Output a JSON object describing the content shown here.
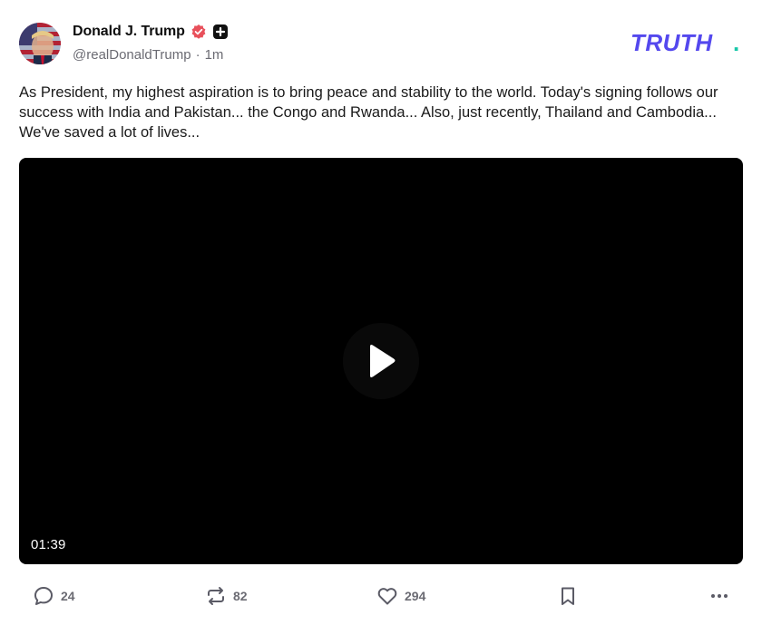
{
  "post": {
    "author": {
      "display_name": "Donald J. Trump",
      "verified_icon": "verified-badge-icon",
      "plus_icon": "plus-square-icon",
      "handle": "@realDonaldTrump",
      "separator": "·",
      "timestamp": "1m",
      "avatar_icon": "avatar-image"
    },
    "brand": {
      "logo_text": "TRUTH",
      "logo_dot": ".",
      "primary_color": "#5448ee",
      "accent_color": "#17c7a8"
    },
    "text": "As President, my highest aspiration is to bring peace and stability to the world. Today's signing follows our success with India and Pakistan... the Congo and Rwanda... Also, just recently, Thailand and Cambodia... We've saved a lot of lives...",
    "video": {
      "duration": "01:39",
      "play_icon": "play-icon"
    },
    "actions": {
      "reply": {
        "icon": "reply-icon",
        "count": "24"
      },
      "retruth": {
        "icon": "retruth-icon",
        "count": "82"
      },
      "like": {
        "icon": "heart-icon",
        "count": "294"
      },
      "bookmark": {
        "icon": "bookmark-icon"
      },
      "more": {
        "icon": "more-options-icon"
      }
    },
    "colors": {
      "verified_badge": "#e8505b",
      "muted_text": "#6b6b73"
    }
  }
}
